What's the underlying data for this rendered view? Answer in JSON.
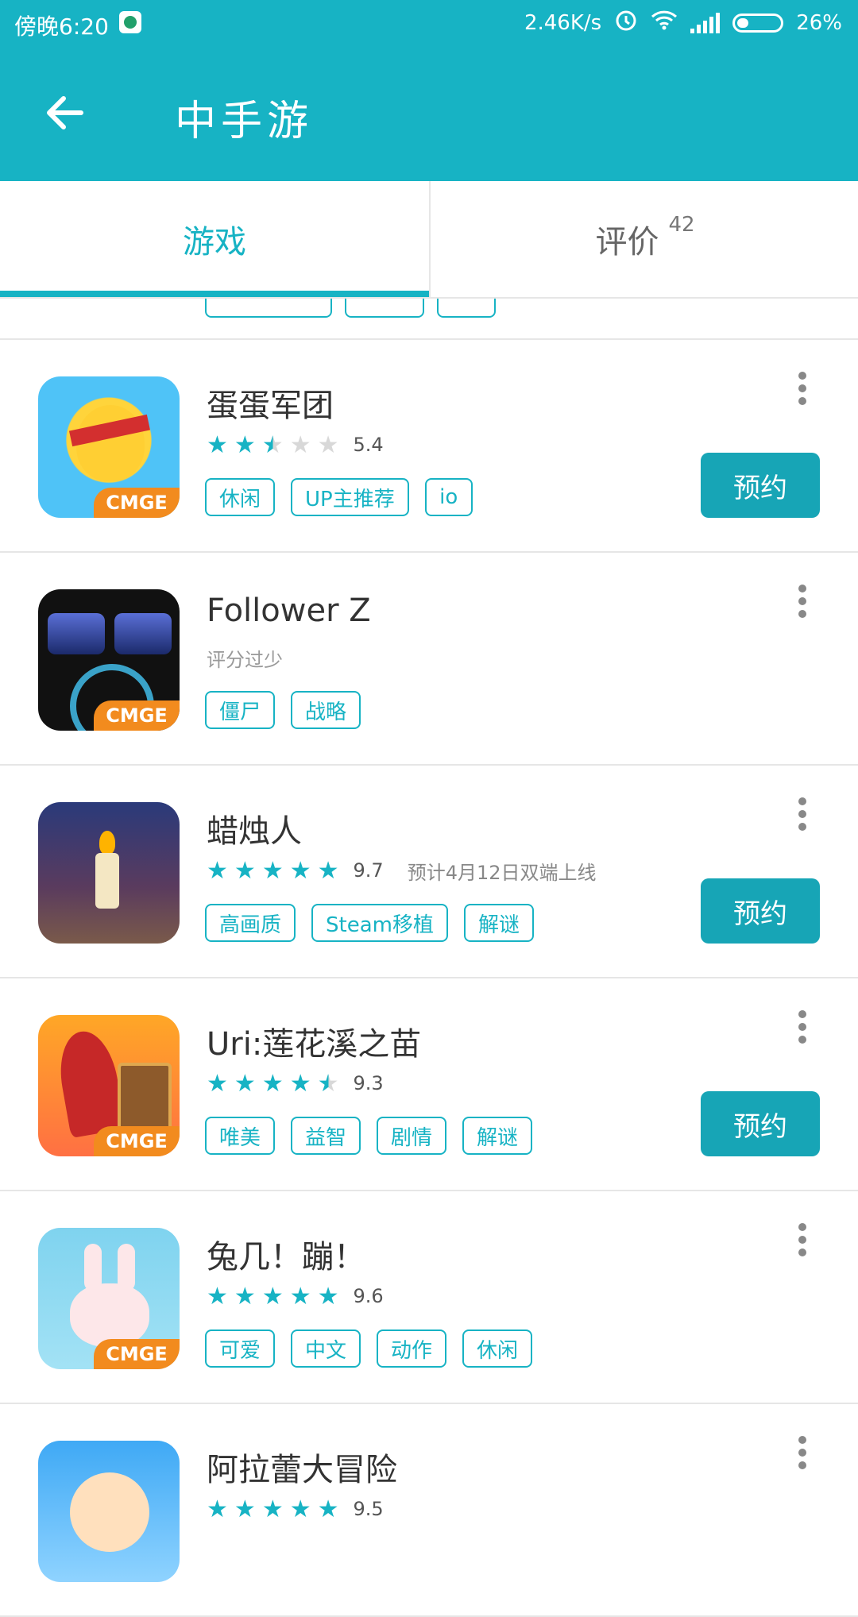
{
  "status_bar": {
    "time": "傍晚6:20",
    "network_speed": "2.46K/s",
    "battery": "26%",
    "icons": [
      "notification-app-icon",
      "alarm-icon",
      "wifi-icon",
      "signal-icon",
      "battery-icon"
    ]
  },
  "app_bar": {
    "title": "中手游",
    "back_icon": "arrow-left-icon"
  },
  "tabs": [
    {
      "label": "游戏",
      "active": true
    },
    {
      "label": "评价",
      "count": "42",
      "active": false
    }
  ],
  "colors": {
    "accent": "#17b3c4",
    "button": "#17a5b6",
    "star_off": "#d8d8d8"
  },
  "games": [
    {
      "name": "蛋蛋军团",
      "rating": "5.4",
      "stars": 2.5,
      "tags": [
        "休闲",
        "UP主推荐",
        "io"
      ],
      "button": "预约",
      "badge": "CMGE"
    },
    {
      "name": "Follower Z",
      "rating_text": "评分过少",
      "tags": [
        "僵尸",
        "战略"
      ],
      "badge": "CMGE"
    },
    {
      "name": "蜡烛人",
      "rating": "9.7",
      "stars": 5,
      "note": "预计4月12日双端上线",
      "tags": [
        "高画质",
        "Steam移植",
        "解谜"
      ],
      "button": "预约"
    },
    {
      "name": "Uri:莲花溪之苗",
      "rating": "9.3",
      "stars": 4.5,
      "tags": [
        "唯美",
        "益智",
        "剧情",
        "解谜"
      ],
      "button": "预约",
      "badge": "CMGE"
    },
    {
      "name": "兔几！蹦！",
      "rating": "9.6",
      "stars": 5,
      "tags": [
        "可爱",
        "中文",
        "动作",
        "休闲"
      ],
      "badge": "CMGE"
    },
    {
      "name": "阿拉蕾大冒险",
      "rating": "9.5",
      "stars": 5,
      "tags": []
    }
  ]
}
